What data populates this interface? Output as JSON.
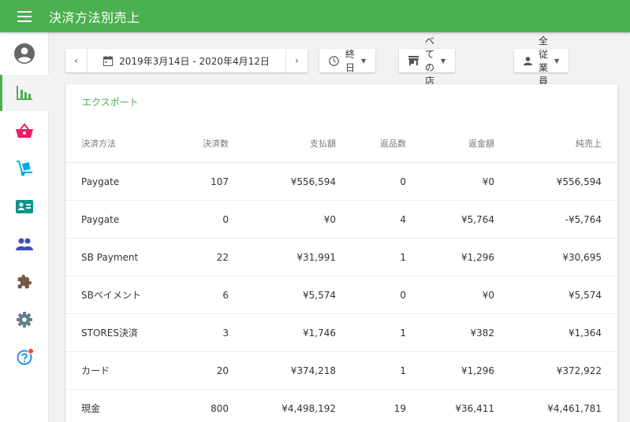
{
  "header": {
    "title": "決済方法別売上"
  },
  "sidebar": {
    "items": [
      {
        "name": "account",
        "icon": "account-circle-icon"
      },
      {
        "name": "reports",
        "icon": "bar-chart-icon",
        "active": true
      },
      {
        "name": "shop",
        "icon": "shopping-basket-icon"
      },
      {
        "name": "logistics",
        "icon": "hand-truck-icon"
      },
      {
        "name": "contacts",
        "icon": "contact-card-icon"
      },
      {
        "name": "staff",
        "icon": "people-icon"
      },
      {
        "name": "extensions",
        "icon": "puzzle-icon"
      },
      {
        "name": "settings",
        "icon": "gear-icon"
      },
      {
        "name": "help",
        "icon": "help-icon",
        "badge": true
      }
    ]
  },
  "filters": {
    "date_range": "2019年3月14日 - 2020年4月12日",
    "time": "終日",
    "store": "すべての店舗",
    "staff": "全従業員"
  },
  "report": {
    "export_label": "エクスポート",
    "columns": [
      "決済方法",
      "決済数",
      "支払額",
      "返品数",
      "返金額",
      "純売上"
    ],
    "rows": [
      [
        "Paygate",
        "107",
        "¥556,594",
        "0",
        "¥0",
        "¥556,594"
      ],
      [
        "Paygate",
        "0",
        "¥0",
        "4",
        "¥5,764",
        "-¥5,764"
      ],
      [
        "SB Payment",
        "22",
        "¥31,991",
        "1",
        "¥1,296",
        "¥30,695"
      ],
      [
        "SBペイメント",
        "6",
        "¥5,574",
        "0",
        "¥0",
        "¥5,574"
      ],
      [
        "STORES決済",
        "3",
        "¥1,746",
        "1",
        "¥382",
        "¥1,364"
      ],
      [
        "カード",
        "20",
        "¥374,218",
        "1",
        "¥1,296",
        "¥372,922"
      ],
      [
        "現金",
        "800",
        "¥4,498,192",
        "19",
        "¥36,411",
        "¥4,461,781"
      ]
    ]
  },
  "colors": {
    "brand": "#4caf50",
    "basket": "#e91e63",
    "truck": "#03a9f4",
    "contact": "#009688",
    "people": "#3f51b5",
    "puzzle": "#795548",
    "gear": "#607d8b",
    "help": "#2196f3",
    "badge": "#f44336"
  }
}
